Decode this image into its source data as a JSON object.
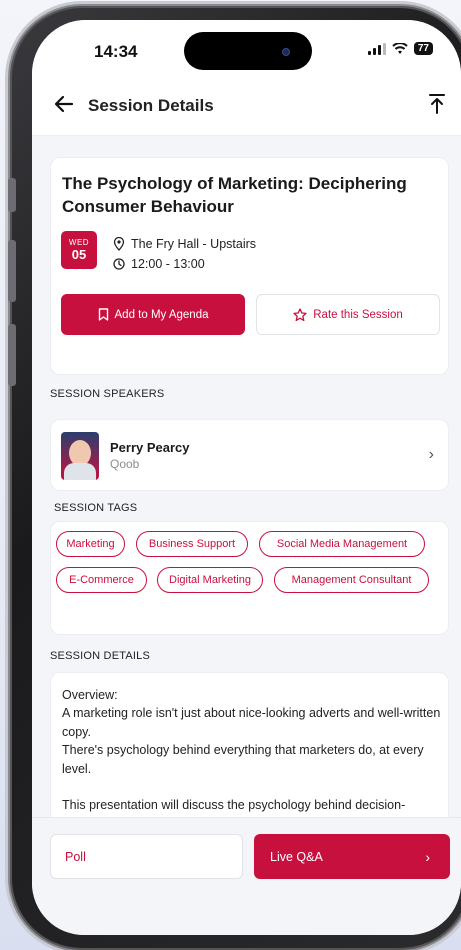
{
  "status_bar": {
    "time": "14:34",
    "battery": "77"
  },
  "header": {
    "title": "Session Details"
  },
  "session": {
    "title": "The Psychology of Marketing: Deciphering Consumer Behaviour",
    "date_dow": "WED",
    "date_day": "05",
    "location": "The Fry Hall - Upstairs",
    "time": "12:00 - 13:00",
    "add_agenda_label": "Add to My Agenda",
    "rate_label": "Rate this Session"
  },
  "speakers": {
    "label": "SESSION SPEAKERS",
    "items": [
      {
        "name": "Perry Pearcy",
        "org": "Qoob"
      }
    ]
  },
  "tags": {
    "label": "SESSION TAGS",
    "items": [
      "Marketing",
      "Business Support",
      "Social Media Management",
      "E-Commerce",
      "Digital Marketing",
      "Management Consultant"
    ]
  },
  "details": {
    "label": "SESSION DETAILS",
    "text": "Overview:\nA marketing role isn't just about nice-looking adverts and well-written copy.\nThere's psychology behind everything that marketers do, at every level.\n\nThis presentation will discuss the psychology behind decision-making.\nEvery customer has purchasing behaviours for you to learn.\nNothing is magic, it's just about understanding how people"
  },
  "footer": {
    "poll_label": "Poll",
    "qa_label": "Live Q&A"
  },
  "colors": {
    "accent": "#c8103f",
    "background": "#f4f5f8"
  }
}
